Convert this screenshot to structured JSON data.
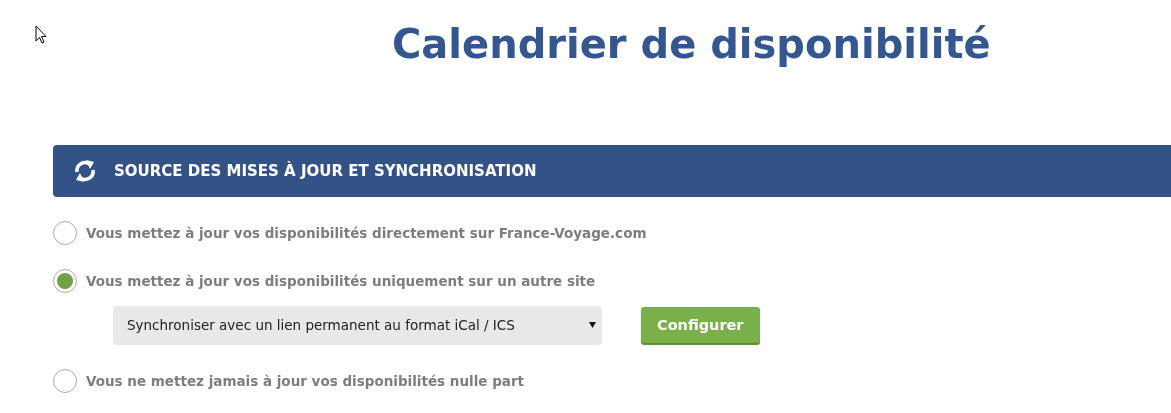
{
  "title": "Calendrier de disponibilité",
  "section": {
    "title": "SOURCE DES MISES À JOUR ET SYNCHRONISATION"
  },
  "options": [
    {
      "label": "Vous mettez à jour vos disponibilités directement sur France-Voyage.com",
      "selected": false
    },
    {
      "label": "Vous mettez à jour vos disponibilités uniquement sur un autre site",
      "selected": true,
      "select": {
        "value": "Synchroniser avec un lien permanent au format iCal / ICS"
      },
      "button": "Configurer"
    },
    {
      "label": "Vous ne mettez jamais à jour vos disponibilités nulle part",
      "selected": false
    }
  ]
}
